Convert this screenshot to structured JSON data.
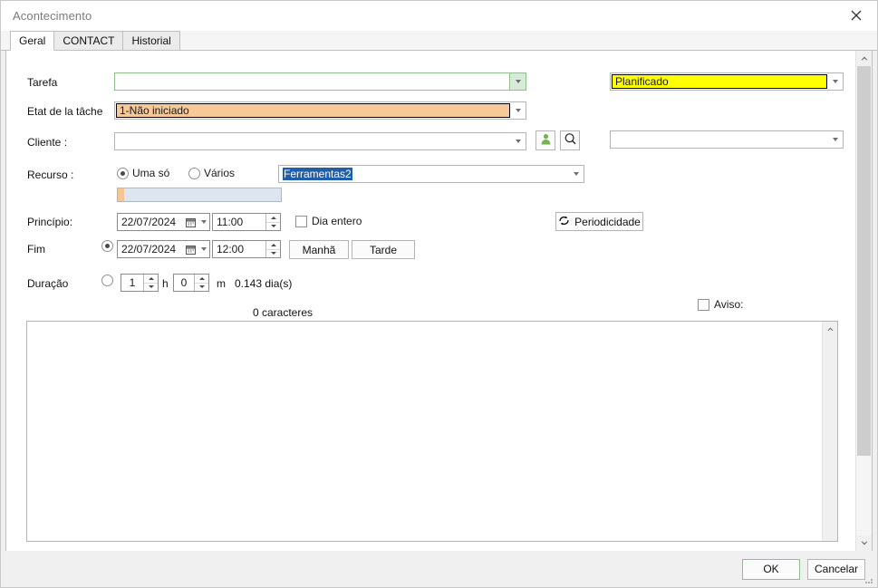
{
  "window": {
    "title": "Acontecimento",
    "close_icon": "close-icon"
  },
  "tabs": [
    {
      "label": "Geral",
      "active": true
    },
    {
      "label": "CONTACT",
      "active": false
    },
    {
      "label": "Historial",
      "active": false
    }
  ],
  "form": {
    "tarefa": {
      "label": "Tarefa",
      "value": ""
    },
    "etat": {
      "label": "Etat de la tâche",
      "value": "1-Não iniciado"
    },
    "cliente": {
      "label": "Cliente :",
      "value": ""
    },
    "status_right": {
      "value": "Planificado"
    },
    "extra_right": {
      "value": ""
    },
    "recurso": {
      "label": "Recurso :",
      "option_single": "Uma só",
      "option_multiple": "Vários",
      "selected": "Uma só",
      "resource_value": "Ferramentas2"
    },
    "principio": {
      "label": "Princípio:",
      "date": "22/07/2024",
      "time": "11:00",
      "all_day_label": "Dia entero",
      "all_day_checked": false
    },
    "fim": {
      "label": "Fim",
      "date": "22/07/2024",
      "time": "12:00",
      "radio_checked": true,
      "morning_label": "Manhã",
      "afternoon_label": "Tarde"
    },
    "duracao": {
      "label": "Duração",
      "radio_checked": false,
      "hours": "1",
      "hours_unit": "h",
      "minutes": "0",
      "minutes_unit": "m",
      "days_text": "0.143 dia(s)"
    },
    "periodicidade": {
      "label": "Periodicidade",
      "icon": "refresh-cycle-icon"
    },
    "aviso": {
      "label": "Aviso:",
      "checked": false
    },
    "char_count": "0 caracteres",
    "memo_value": ""
  },
  "buttons": {
    "client_person_icon": "person-icon",
    "client_search_icon": "search-icon",
    "ok": "OK",
    "cancel": "Cancelar"
  },
  "colors": {
    "highlight_yellow": "#ffff00",
    "highlight_orange": "#f7c999",
    "accent_green": "#8fbf8f",
    "selection_blue": "#1f5ea8"
  }
}
